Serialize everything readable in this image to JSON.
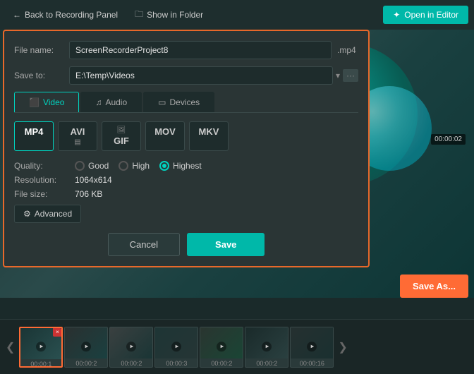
{
  "topbar": {
    "back_label": "Back to Recording Panel",
    "show_folder_label": "Show in Folder",
    "open_editor_label": "Open in Editor"
  },
  "dialog": {
    "file_name_label": "File name:",
    "file_name_value": "ScreenRecorderProject8",
    "file_ext": ".mp4",
    "save_to_label": "Save to:",
    "save_path": "E:\\Temp\\Videos",
    "tabs": [
      {
        "id": "video",
        "label": "Video",
        "active": true
      },
      {
        "id": "audio",
        "label": "Audio",
        "active": false
      },
      {
        "id": "devices",
        "label": "Devices",
        "active": false
      }
    ],
    "formats": [
      {
        "id": "mp4",
        "label": "MP4",
        "icon": "",
        "active": true
      },
      {
        "id": "avi",
        "label": "AVI",
        "icon": "▤",
        "active": false
      },
      {
        "id": "gif",
        "label": "GIF",
        "icon": "GIF",
        "active": false
      },
      {
        "id": "mov",
        "label": "MOV",
        "icon": "",
        "active": false
      },
      {
        "id": "mkv",
        "label": "MKV",
        "icon": "",
        "active": false
      }
    ],
    "quality_label": "Quality:",
    "quality_options": [
      {
        "id": "good",
        "label": "Good",
        "checked": false
      },
      {
        "id": "high",
        "label": "High",
        "checked": false
      },
      {
        "id": "highest",
        "label": "Highest",
        "checked": true
      }
    ],
    "resolution_label": "Resolution:",
    "resolution_value": "1064x614",
    "filesize_label": "File size:",
    "filesize_value": "706 KB",
    "advanced_label": "Advanced",
    "cancel_label": "Cancel",
    "save_label": "Save"
  },
  "save_as_label": "Save As...",
  "time_badge": "00:00:02",
  "timeline": {
    "thumbs": [
      {
        "time": "00:00:1",
        "active": true
      },
      {
        "time": "00:00:2",
        "active": false
      },
      {
        "time": "00:00:2",
        "active": false
      },
      {
        "time": "00:00:3",
        "active": false
      },
      {
        "time": "00:00:2",
        "active": false
      },
      {
        "time": "00:00:2",
        "active": false
      },
      {
        "time": "00:00:16",
        "active": false
      }
    ]
  }
}
